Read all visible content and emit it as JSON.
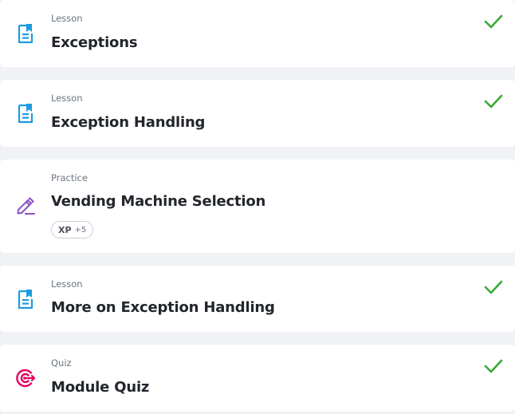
{
  "items": [
    {
      "type": "Lesson",
      "title": "Exceptions",
      "icon": "lesson-icon",
      "completed": true
    },
    {
      "type": "Lesson",
      "title": "Exception Handling",
      "icon": "lesson-icon",
      "completed": true
    },
    {
      "type": "Practice",
      "title": "Vending Machine Selection",
      "icon": "practice-pencil-icon",
      "completed": false,
      "xp_label": "XP",
      "xp_value": "+5"
    },
    {
      "type": "Lesson",
      "title": "More on Exception Handling",
      "icon": "lesson-icon",
      "completed": true
    },
    {
      "type": "Quiz",
      "title": "Module Quiz",
      "icon": "quiz-target-icon",
      "completed": true
    }
  ],
  "colors": {
    "lesson_icon": "#1e9be0",
    "practice_icon": "#8b4fc7",
    "quiz_icon": "#e5005c",
    "check": "#3aa935"
  }
}
